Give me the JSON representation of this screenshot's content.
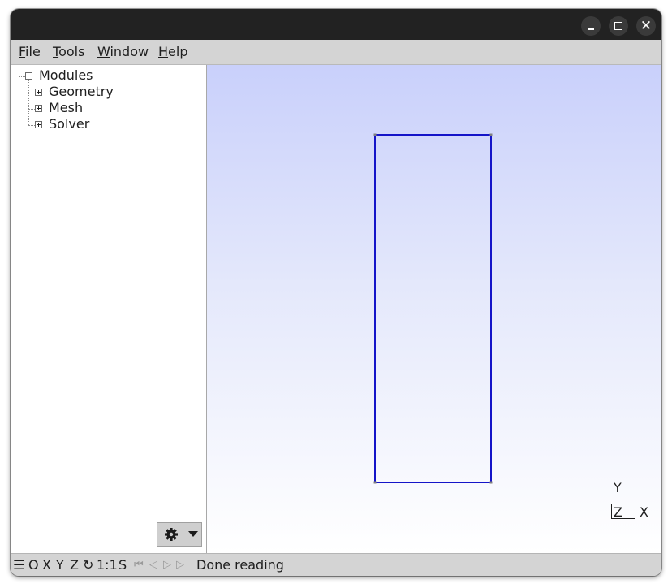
{
  "menubar": {
    "items": [
      {
        "mnemonic": "F",
        "rest": "ile"
      },
      {
        "mnemonic": "T",
        "rest": "ools"
      },
      {
        "mnemonic": "W",
        "rest": "indow"
      },
      {
        "mnemonic": "H",
        "rest": "elp"
      }
    ]
  },
  "tree": {
    "root": "Modules",
    "children": [
      "Geometry",
      "Mesh",
      "Solver"
    ]
  },
  "statusbar": {
    "menu_glyph": "☰",
    "view_o": "O",
    "view_x": "X",
    "view_y": "Y",
    "view_z": "Z",
    "rotate_glyph": "↻",
    "scale": "1:1",
    "select": "S",
    "first_glyph": "⏮",
    "prev_glyph": "◁",
    "play_glyph": "▷",
    "next_glyph": "▷",
    "message": "Done reading"
  },
  "axes": {
    "y": "Y",
    "z": "Z",
    "x": "X"
  },
  "colors": {
    "shape_stroke": "#1414c8",
    "vertex": "#808080",
    "viewport_top": "#c9d0fb",
    "viewport_bottom": "#ffffff"
  }
}
